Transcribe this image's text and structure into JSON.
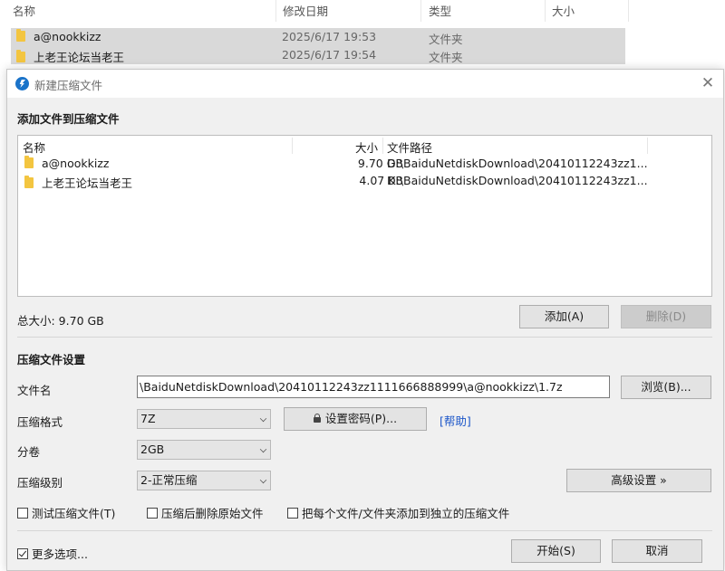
{
  "explorer": {
    "columns": [
      "名称",
      "修改日期",
      "类型",
      "大小"
    ],
    "rows": [
      {
        "name": "a@nookkizz",
        "date": "2025/6/17 19:53",
        "type": "文件夹"
      },
      {
        "name": "上老王论坛当老王",
        "date": "2025/6/17 19:54",
        "type": "文件夹"
      }
    ]
  },
  "dialog": {
    "title": "新建压缩文件",
    "close_icon": "close-icon",
    "add_section_title": "添加文件到压缩文件",
    "list_columns": {
      "name": "名称",
      "size": "大小",
      "path": "文件路径"
    },
    "files": [
      {
        "name": "a@nookkizz",
        "size": "9.70 GB",
        "path": "D:\\BaiduNetdiskDownload\\20410112243zz1..."
      },
      {
        "name": "上老王论坛当老王",
        "size": "4.07 KB",
        "path": "D:\\BaiduNetdiskDownload\\20410112243zz1..."
      }
    ],
    "total_size": "总大小: 9.70 GB",
    "add_button": "添加(A)",
    "delete_button": "删除(D)",
    "settings_title": "压缩文件设置",
    "filename_label": "文件名",
    "filename_value": "\\BaiduNetdiskDownload\\20410112243zz1111666888999\\a@nookkizz\\1.7z",
    "browse_button": "浏览(B)...",
    "format_label": "压缩格式",
    "format_value": "7Z",
    "password_button": "设置密码(P)...",
    "help_link": "[帮助]",
    "split_label": "分卷",
    "split_value": "2GB",
    "level_label": "压缩级别",
    "level_value": "2-正常压缩",
    "advanced_button": "高级设置 »",
    "test_checkbox": {
      "label": "测试压缩文件(T)",
      "checked": false
    },
    "delete_after_checkbox": {
      "label": "压缩后删除原始文件",
      "checked": false
    },
    "separate_checkbox": {
      "label": "把每个文件/文件夹添加到独立的压缩文件",
      "checked": false
    },
    "more_options_checkbox": {
      "label": "更多选项...",
      "checked": true
    },
    "start_button": "开始(S)",
    "cancel_button": "取消"
  },
  "colors": {
    "accent": "#1a73c9",
    "folder": "#f3c540",
    "link": "#1a55c8",
    "selection_bg": "#d9d9d9"
  }
}
